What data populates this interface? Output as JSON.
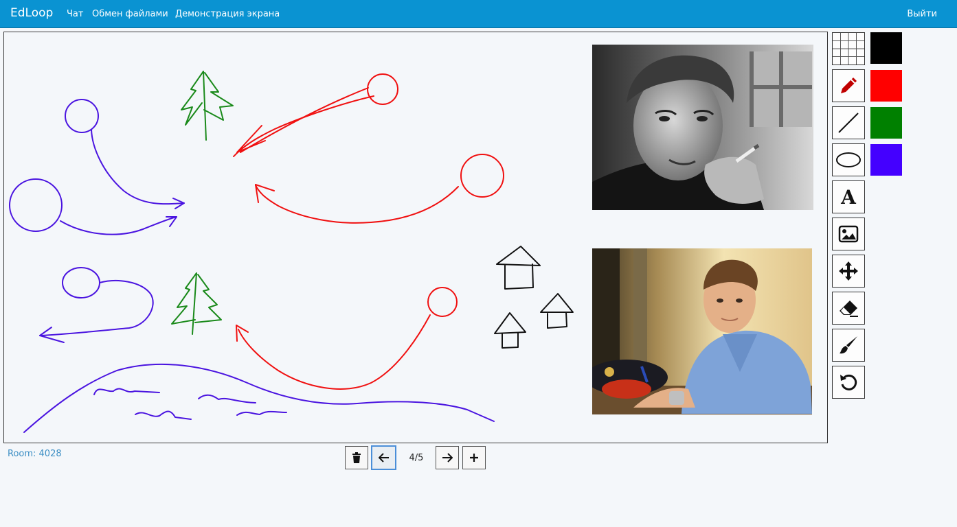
{
  "navbar": {
    "brand": "EdLoop",
    "items": [
      {
        "label": "Чат"
      },
      {
        "label": "Обмен файлами"
      },
      {
        "label": "Демонстрация экрана"
      }
    ],
    "logout_label": "Выйти"
  },
  "toolbar": {
    "tools": [
      {
        "icon": "grid-icon"
      },
      {
        "icon": "pencil-icon"
      },
      {
        "icon": "line-icon"
      },
      {
        "icon": "ellipse-icon"
      },
      {
        "icon": "text-icon",
        "glyph": "A"
      },
      {
        "icon": "image-icon"
      },
      {
        "icon": "move-icon"
      },
      {
        "icon": "eraser-icon"
      },
      {
        "icon": "brush-icon"
      },
      {
        "icon": "undo-icon"
      }
    ],
    "colors": [
      "#000000",
      "#ff0000",
      "#008000",
      "#4400ff"
    ]
  },
  "status": {
    "room": "Room: 4028",
    "page": "4/5"
  },
  "colors": {
    "navbar": "#0a93d2",
    "ink_blue": "#4a14e0",
    "ink_red": "#f01010",
    "ink_green": "#1a8a1a",
    "ink_black": "#111111"
  }
}
